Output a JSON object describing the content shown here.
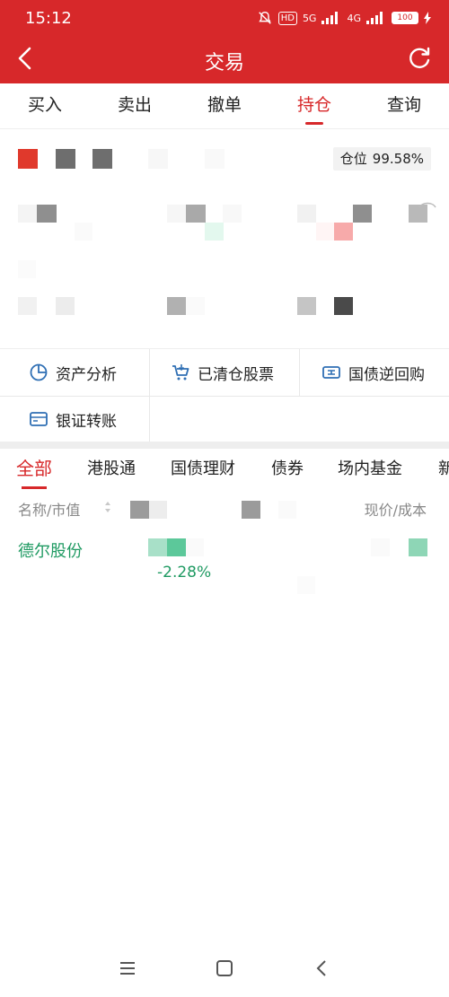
{
  "status_bar": {
    "time": "15:12",
    "network1": "5G",
    "network2": "4G",
    "battery": "100"
  },
  "header": {
    "title": "交易"
  },
  "tabs": [
    {
      "label": "买入",
      "active": false
    },
    {
      "label": "卖出",
      "active": false
    },
    {
      "label": "撤单",
      "active": false
    },
    {
      "label": "持仓",
      "active": true
    },
    {
      "label": "查询",
      "active": false
    }
  ],
  "position_badge": {
    "label": "仓位",
    "value": "99.58%"
  },
  "actions": [
    {
      "label": "资产分析",
      "icon": "pie-chart-icon"
    },
    {
      "label": "已清仓股票",
      "icon": "cart-icon"
    },
    {
      "label": "国债逆回购",
      "icon": "ticket-icon"
    },
    {
      "label": "银证转账",
      "icon": "card-icon"
    }
  ],
  "sub_tabs": [
    {
      "label": "全部",
      "active": true
    },
    {
      "label": "港股通",
      "active": false
    },
    {
      "label": "国债理财",
      "active": false
    },
    {
      "label": "债券",
      "active": false
    },
    {
      "label": "场内基金",
      "active": false
    },
    {
      "label": "新",
      "active": false
    }
  ],
  "list_header": {
    "left": "名称/市值",
    "right": "现价/成本"
  },
  "holdings": [
    {
      "name": "德尔股份",
      "change_pct": "-2.28%"
    }
  ],
  "colors": {
    "brand_red": "#d7282a",
    "down_green": "#1f9a62",
    "icon_blue": "#2f6fb4"
  }
}
